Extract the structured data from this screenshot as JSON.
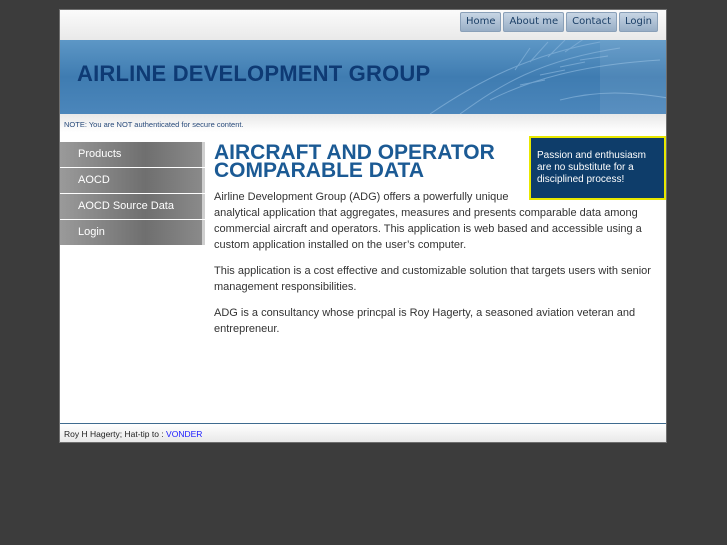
{
  "topnav": {
    "items": [
      "Home",
      "About me",
      "Contact",
      "Login"
    ]
  },
  "banner": {
    "title": "AIRLINE DEVELOPMENT GROUP"
  },
  "note": "NOTE: You are NOT authenticated for secure content.",
  "sidebar": {
    "items": [
      "Products",
      "AOCD",
      "AOCD Source Data",
      "Login"
    ]
  },
  "main": {
    "heading": "AIRCRAFT AND OPERATOR COMPARABLE DATA",
    "callout": "Passion and enthusiasm are no substitute for a disciplined process!",
    "paragraphs": [
      "Airline Development Group (ADG) offers a powerfully unique analytical application that aggregates, measures and presents comparable data among commercial aircraft and operators. This application is web based and accessible using a custom application installed on the user’s computer.",
      "This application is a cost effective and customizable solution that targets users with senior management responsibilities.",
      "ADG is a consultancy whose princpal is Roy Hagerty, a seasoned aviation veteran and entrepreneur."
    ]
  },
  "footer": {
    "text": "Roy H Hagerty;  Hat-tip to : ",
    "link": "VONDER"
  },
  "colors": {
    "page_bg": "#3c3c3c",
    "banner": "#4b86bb",
    "title": "#0e3a74",
    "callout_bg": "#0e3d6a",
    "callout_border": "#e8e800"
  }
}
